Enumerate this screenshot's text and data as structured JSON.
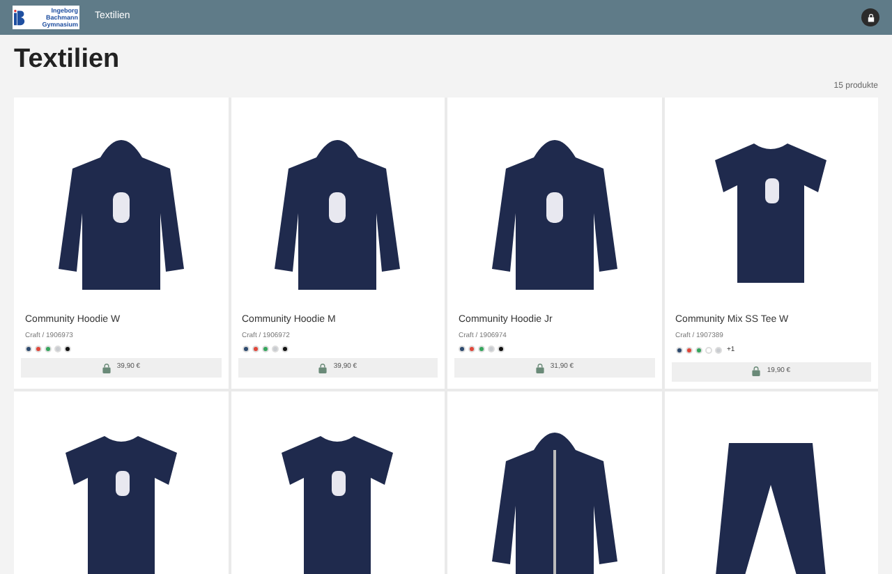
{
  "header": {
    "logo_lines": [
      "Ingeborg",
      "Bachmann",
      "Gymnasium"
    ],
    "nav": "Textilien"
  },
  "page": {
    "title": "Textilien",
    "count": "15 produkte"
  },
  "products": [
    {
      "kind": "hoodie",
      "name": "Community Hoodie W",
      "sku": "Craft / 1906973",
      "colors": [
        {
          "color": "#2d4a6e"
        },
        {
          "color": "#e0473a"
        },
        {
          "color": "#35a55c"
        },
        {
          "color": "#c9ccd0"
        },
        {
          "color": "#111111"
        }
      ],
      "price": "39,90 €"
    },
    {
      "kind": "hoodie",
      "name": "Community Hoodie M",
      "sku": "Craft / 1906972",
      "colors": [
        {
          "color": "#2d4a6e"
        },
        {
          "color": "#e0473a"
        },
        {
          "color": "#35a55c"
        },
        {
          "color": "#c9ccd0"
        },
        {
          "color": "#111111"
        }
      ],
      "price": "39,90 €"
    },
    {
      "kind": "hoodie",
      "name": "Community Hoodie Jr",
      "sku": "Craft / 1906974",
      "colors": [
        {
          "color": "#2d4a6e"
        },
        {
          "color": "#e0473a"
        },
        {
          "color": "#35a55c"
        },
        {
          "color": "#c9ccd0"
        },
        {
          "color": "#111111"
        }
      ],
      "price": "31,90 €"
    },
    {
      "kind": "tee",
      "name": "Community Mix SS Tee W",
      "sku": "Craft / 1907389",
      "colors": [
        {
          "color": "#2d4a6e"
        },
        {
          "color": "#e0473a"
        },
        {
          "color": "#35a55c"
        },
        {
          "color": "#ffffff"
        },
        {
          "color": "#c9ccd0"
        }
      ],
      "more": "+1",
      "price": "19,90 €"
    },
    {
      "kind": "tee"
    },
    {
      "kind": "tee"
    },
    {
      "kind": "jacket"
    },
    {
      "kind": "pants"
    }
  ]
}
